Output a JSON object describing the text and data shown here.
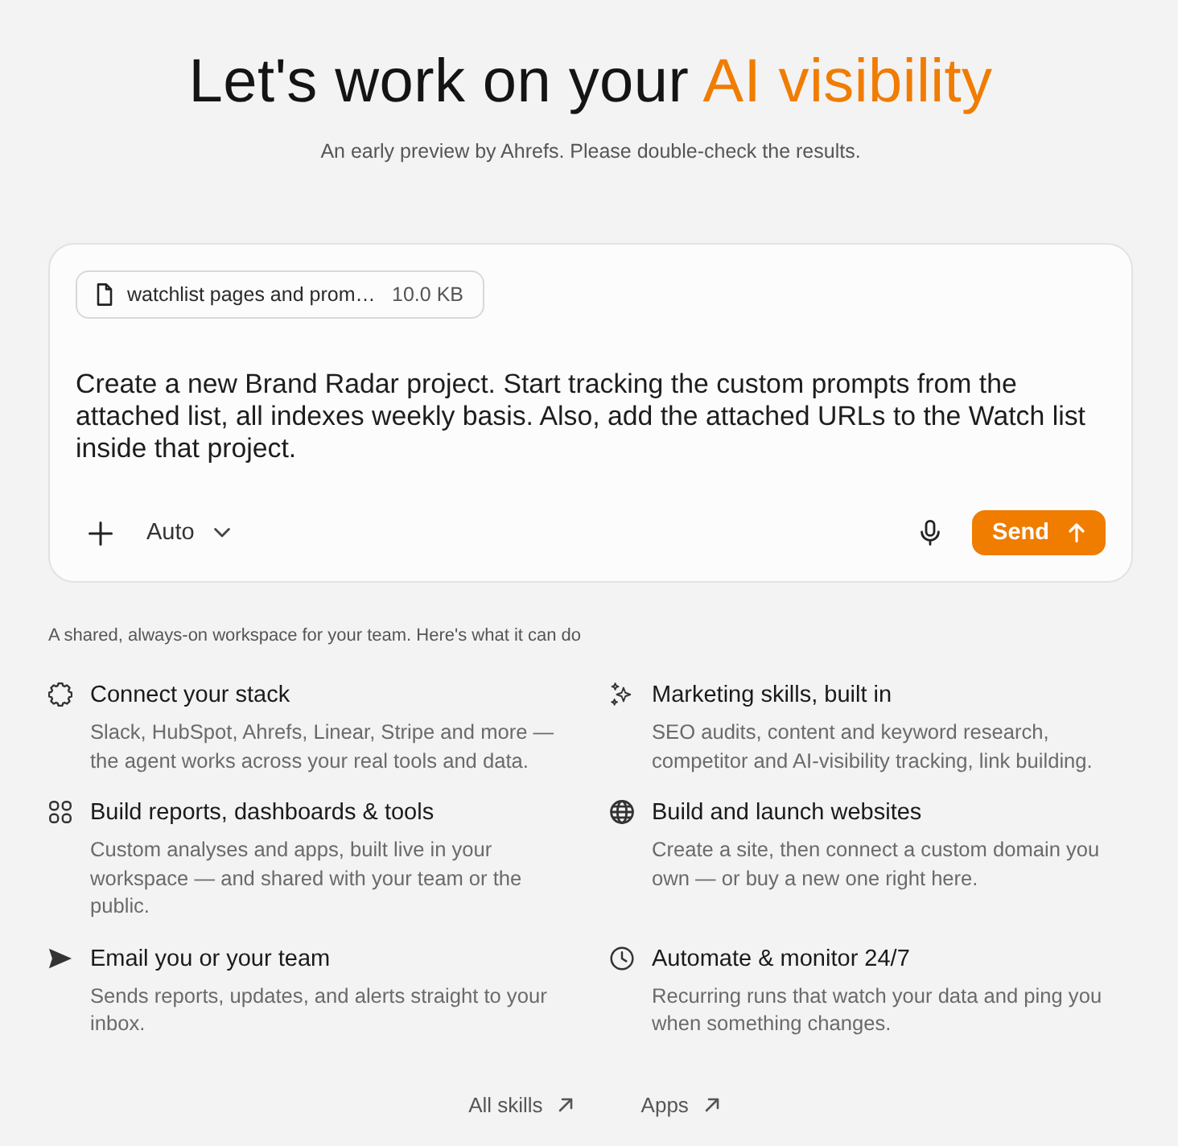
{
  "header": {
    "title": "Let's work on your",
    "title_highlight": "AI visibility",
    "subtitle": "An early preview by Ahrefs. Please double-check the results."
  },
  "composer": {
    "attachment": {
      "name": "watchlist pages and prom…",
      "size": "10.0 KB"
    },
    "prompt": {
      "value": "Create a new Brand Radar project. Start tracking the custom prompts from the attached list, all indexes weekly basis. Also, add the attached URLs to the Watch list inside that project."
    },
    "mode": "Auto",
    "send_button": "Send"
  },
  "intro": "A shared, always-on workspace for your team. Here's what it can do",
  "features": [
    {
      "title": "Connect your stack",
      "description": "Slack, HubSpot, Ahrefs, Linear, Stripe and more — the agent works across your real tools and data."
    },
    {
      "title": "Marketing skills, built in",
      "description": "SEO audits, content and keyword research, competitor and AI-visibility tracking, link building."
    },
    {
      "title": "Build reports, dashboards & tools",
      "description": "Custom analyses and apps, built live in your workspace — and shared with your team or the public."
    },
    {
      "title": "Build and launch websites",
      "description": "Create a site, then connect a custom domain you own — or buy a new one right here."
    },
    {
      "title": "Email you or your team",
      "description": "Sends reports, updates, and alerts straight to your inbox."
    },
    {
      "title": "Automate & monitor 24/7",
      "description": "Recurring runs that watch your data and ping you when something changes."
    }
  ],
  "links": [
    "All skills",
    "Apps"
  ]
}
